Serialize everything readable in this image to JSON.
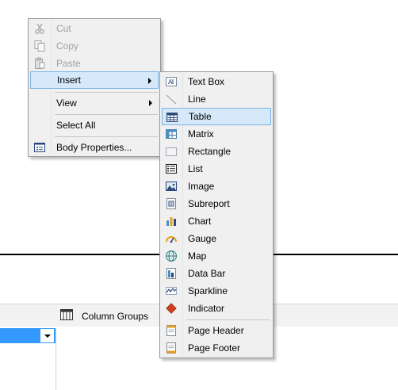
{
  "context_menu": {
    "items": [
      {
        "label": "Cut",
        "icon": "cut-icon",
        "enabled": false
      },
      {
        "label": "Copy",
        "icon": "copy-icon",
        "enabled": false
      },
      {
        "label": "Paste",
        "icon": "paste-icon",
        "enabled": false
      },
      {
        "label": "Insert",
        "submenu": true,
        "highlighted": true
      },
      {
        "label": "View",
        "submenu": true
      },
      {
        "label": "Select All"
      },
      {
        "label": "Body Properties...",
        "icon": "properties-icon"
      }
    ]
  },
  "insert_submenu": {
    "items": [
      {
        "label": "Text Box",
        "icon": "text-box-icon"
      },
      {
        "label": "Line",
        "icon": "line-icon"
      },
      {
        "label": "Table",
        "icon": "table-icon",
        "highlighted": true
      },
      {
        "label": "Matrix",
        "icon": "matrix-icon"
      },
      {
        "label": "Rectangle",
        "icon": "rectangle-icon"
      },
      {
        "label": "List",
        "icon": "list-icon"
      },
      {
        "label": "Image",
        "icon": "image-icon"
      },
      {
        "label": "Subreport",
        "icon": "subreport-icon"
      },
      {
        "label": "Chart",
        "icon": "chart-icon"
      },
      {
        "label": "Gauge",
        "icon": "gauge-icon"
      },
      {
        "label": "Map",
        "icon": "map-icon"
      },
      {
        "label": "Data Bar",
        "icon": "data-bar-icon"
      },
      {
        "label": "Sparkline",
        "icon": "sparkline-icon"
      },
      {
        "label": "Indicator",
        "icon": "indicator-icon"
      },
      {
        "label": "Page Header",
        "icon": "page-header-icon"
      },
      {
        "label": "Page Footer",
        "icon": "page-footer-icon"
      }
    ]
  },
  "grouping_pane": {
    "column_groups_label": "Column Groups",
    "icon": "column-groups-icon"
  },
  "colors": {
    "highlight_bg": "#d5e9fb",
    "highlight_border": "#7ab3e8",
    "selection_blue": "#3399ff"
  }
}
